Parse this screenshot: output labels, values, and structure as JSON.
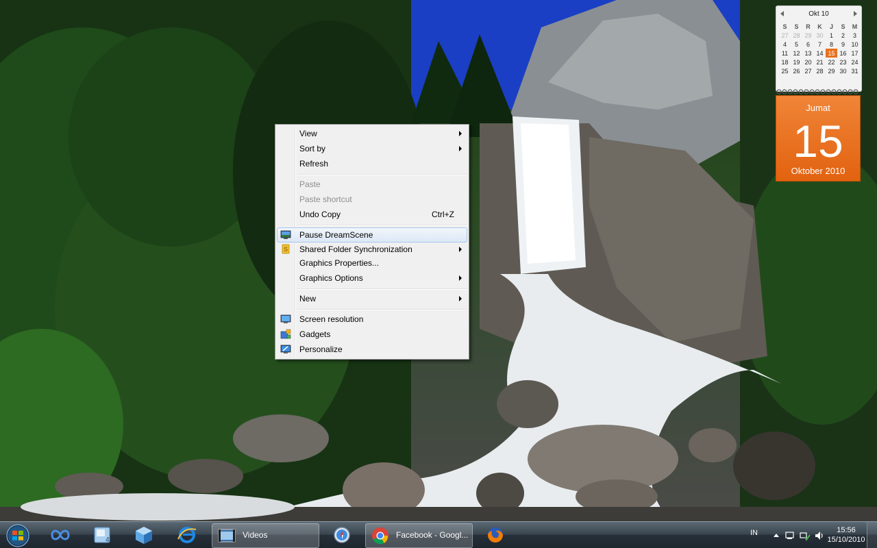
{
  "context_menu": {
    "items": [
      {
        "label": "View",
        "submenu": true
      },
      {
        "label": "Sort by",
        "submenu": true
      },
      {
        "label": "Refresh"
      },
      {
        "label": "Paste",
        "disabled": true
      },
      {
        "label": "Paste shortcut",
        "disabled": true
      },
      {
        "label": "Undo Copy",
        "shortcut": "Ctrl+Z"
      },
      {
        "label": "Pause DreamScene",
        "icon": "dreamscene-icon",
        "highlighted": true
      },
      {
        "label": "Shared Folder Synchronization",
        "icon": "sync-icon",
        "submenu": true
      },
      {
        "label": "Graphics Properties..."
      },
      {
        "label": "Graphics Options",
        "submenu": true
      },
      {
        "label": "New",
        "submenu": true
      },
      {
        "label": "Screen resolution",
        "icon": "monitor-icon"
      },
      {
        "label": "Gadgets",
        "icon": "gadgets-icon"
      },
      {
        "label": "Personalize",
        "icon": "personalize-icon"
      }
    ]
  },
  "calendar_gadget": {
    "month_label": "Okt 10",
    "weekdays": [
      "S",
      "S",
      "R",
      "K",
      "J",
      "S",
      "M"
    ],
    "weeks": [
      [
        "27",
        "28",
        "29",
        "30",
        "1",
        "2",
        "3"
      ],
      [
        "4",
        "5",
        "6",
        "7",
        "8",
        "9",
        "10"
      ],
      [
        "11",
        "12",
        "13",
        "14",
        "15",
        "16",
        "17"
      ],
      [
        "18",
        "19",
        "20",
        "21",
        "22",
        "23",
        "24"
      ],
      [
        "25",
        "26",
        "27",
        "28",
        "29",
        "30",
        "31"
      ]
    ],
    "today_day_name": "Jumat",
    "today_number": "15",
    "today_month_year": "Oktober 2010"
  },
  "taskbar": {
    "pinned": [
      {
        "name": "windows-live-icon"
      },
      {
        "name": "folder-app-icon"
      },
      {
        "name": "cube-app-icon"
      },
      {
        "name": "internet-explorer-icon"
      }
    ],
    "tasks": [
      {
        "label": "Videos",
        "icon": "videos-folder-icon"
      },
      {
        "label": "",
        "icon": "safari-icon"
      },
      {
        "label": "Facebook - Googl...",
        "icon": "chrome-icon"
      },
      {
        "label": "",
        "icon": "firefox-icon"
      }
    ],
    "tray": {
      "language": "IN",
      "time": "15:56",
      "date": "15/10/2010"
    }
  },
  "colors": {
    "menu_bg": "#f0f0f0",
    "highlight_border": "#a8c8eb",
    "calendar_accent": "#e9701d"
  }
}
